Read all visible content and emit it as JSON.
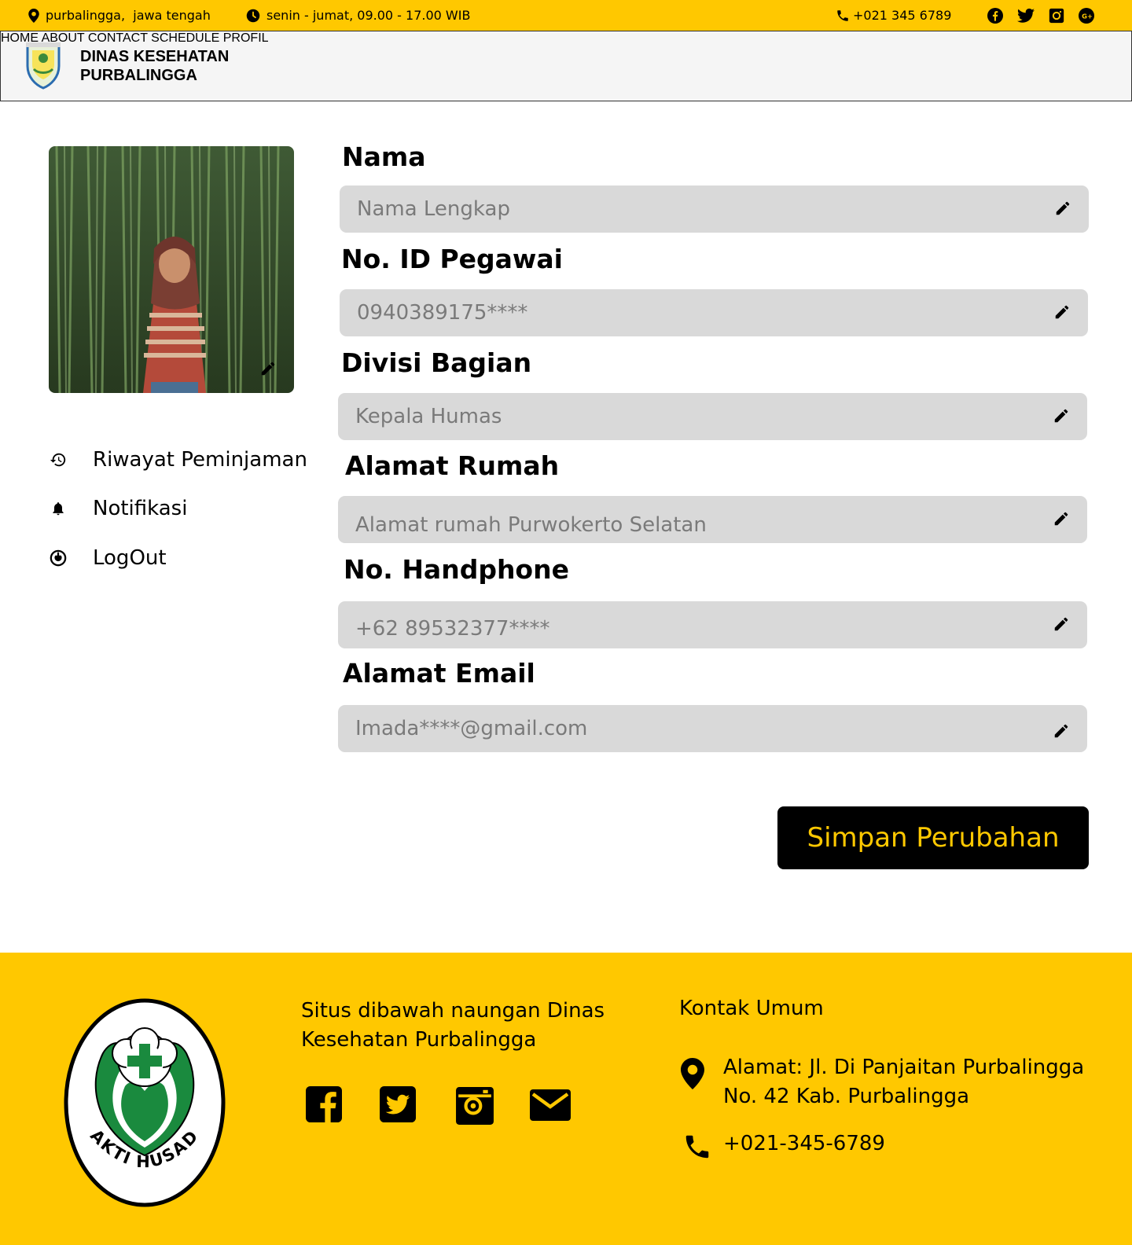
{
  "topbar": {
    "location": "purbalingga,  jawa tengah",
    "hours": "senin - jumat, 09.00 - 17.00 WIB",
    "phone": "+021 345 6789",
    "social_icons": [
      "facebook-icon",
      "twitter-icon",
      "instagram-icon",
      "google-plus-icon"
    ],
    "color": "#FFC800"
  },
  "header": {
    "brand_line1": "DINAS KESEHATAN",
    "brand_line2": "PURBALINGGA",
    "nav": [
      "HOME",
      "ABOUT",
      "CONTACT",
      "SCHEDULE",
      "PROFIL"
    ]
  },
  "sidebar": {
    "items": [
      {
        "label": "Riwayat Peminjaman",
        "icon": "history-icon"
      },
      {
        "label": "Notifikasi",
        "icon": "bell-icon"
      },
      {
        "label": "LogOut",
        "icon": "power-icon"
      }
    ]
  },
  "form": {
    "fields": [
      {
        "label": "Nama",
        "placeholder": "Nama Lengkap"
      },
      {
        "label": "No. ID Pegawai",
        "placeholder": "0940389175****"
      },
      {
        "label": "Divisi Bagian",
        "placeholder": "Kepala Humas"
      },
      {
        "label": "Alamat Rumah",
        "placeholder": "Alamat rumah Purwokerto Selatan"
      },
      {
        "label": "No. Handphone",
        "placeholder": "+62 89532377****"
      },
      {
        "label": "Alamat Email",
        "placeholder": "Imada****@gmail.com"
      }
    ],
    "save_label": "Simpan Perubahan"
  },
  "footer": {
    "logo_text": "BAKTI HUSADA",
    "description": "Situs dibawah naungan Dinas Kesehatan Purbalingga",
    "social_icons": [
      "facebook-icon",
      "twitter-icon",
      "instagram-icon",
      "mail-icon"
    ],
    "contact_title": "Kontak Umum",
    "address": "Alamat: Jl. Di Panjaitan Purbalingga No. 42 Kab. Purbalingga",
    "phone": "+021-345-6789"
  }
}
